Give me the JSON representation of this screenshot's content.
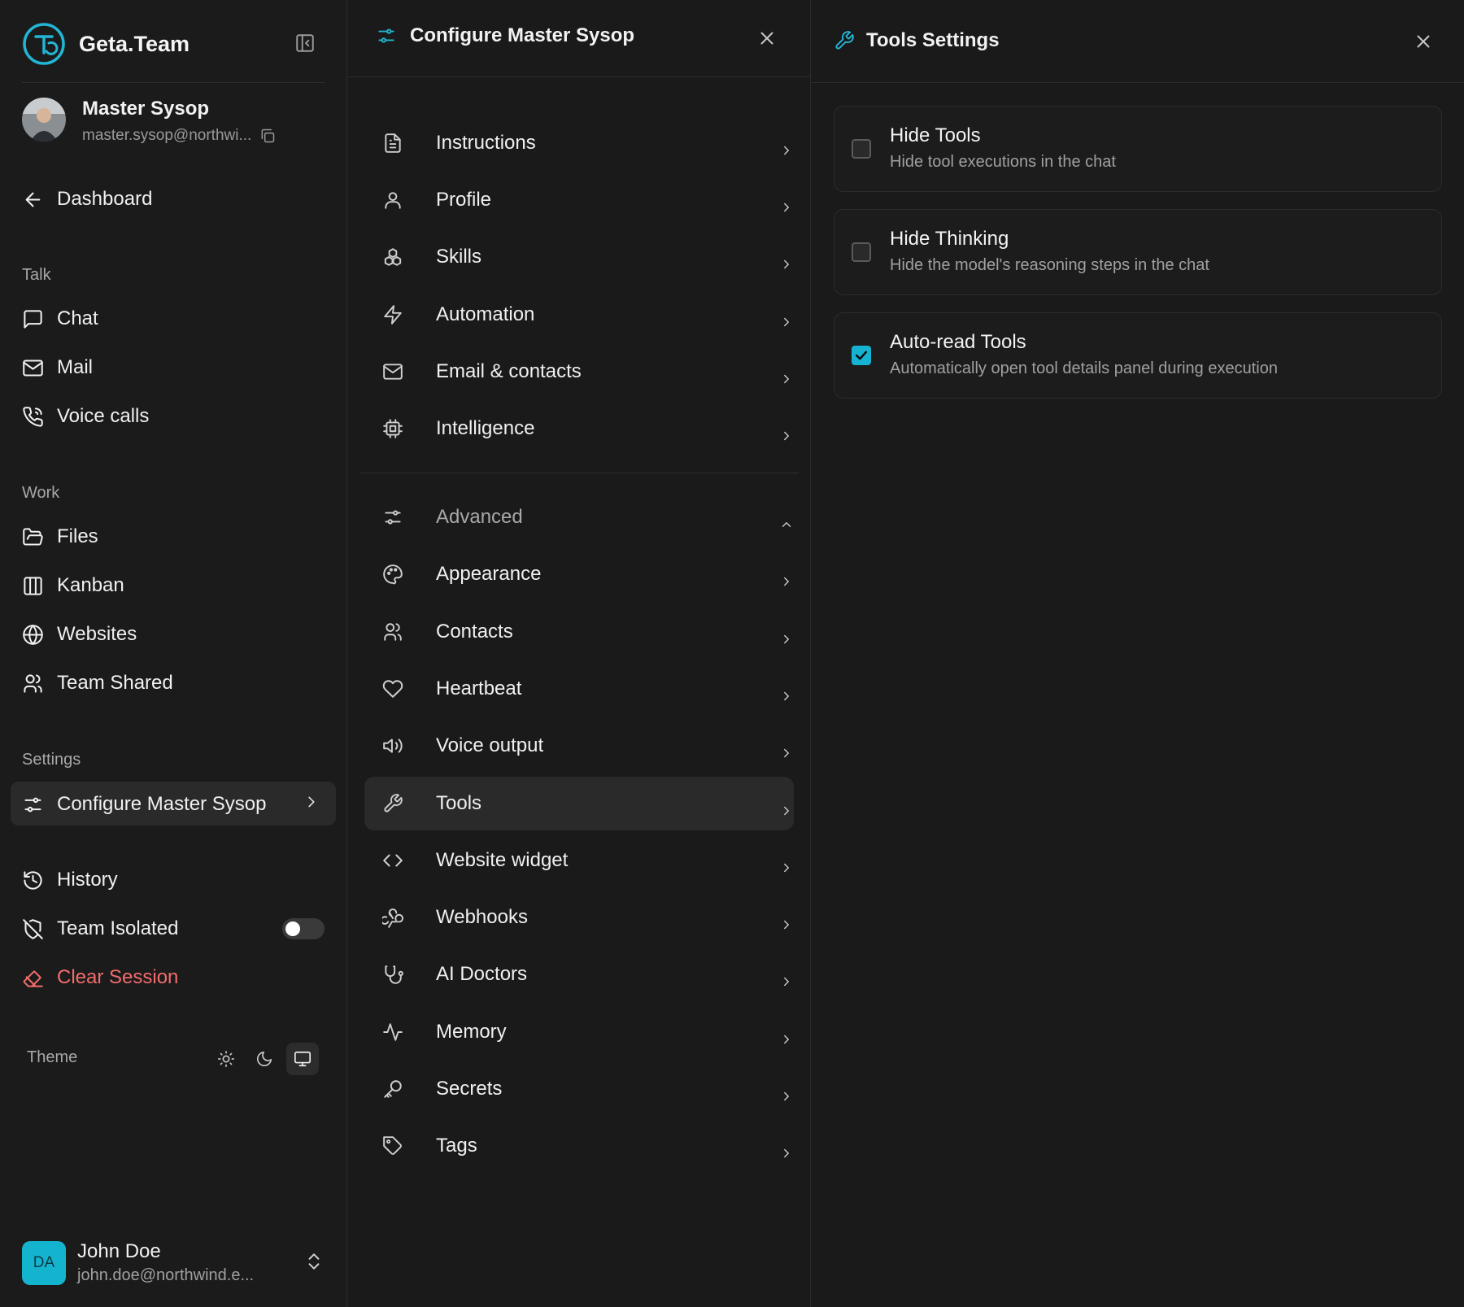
{
  "brand": {
    "name": "Geta.Team",
    "accent": "#22b5d4"
  },
  "user": {
    "name": "Master Sysop",
    "email": "master.sysop@northwi..."
  },
  "nav": {
    "dashboard": "Dashboard",
    "talk_label": "Talk",
    "chat": "Chat",
    "mail": "Mail",
    "voice_calls": "Voice calls",
    "work_label": "Work",
    "files": "Files",
    "kanban": "Kanban",
    "websites": "Websites",
    "team_shared": "Team Shared",
    "settings_label": "Settings",
    "configure": "Configure Master Sysop",
    "history": "History",
    "team_isolated": "Team Isolated",
    "team_isolated_on": false,
    "clear_session": "Clear Session",
    "theme_label": "Theme",
    "theme_selected": "system"
  },
  "footer_user": {
    "initials": "DA",
    "name": "John Doe",
    "email": "john.doe@northwind.e..."
  },
  "config": {
    "title": "Configure Master Sysop",
    "items": [
      {
        "label": "Instructions",
        "icon": "document-icon"
      },
      {
        "label": "Profile",
        "icon": "user-icon"
      },
      {
        "label": "Skills",
        "icon": "skills-icon"
      },
      {
        "label": "Automation",
        "icon": "lightning-icon"
      },
      {
        "label": "Email & contacts",
        "icon": "mail-icon"
      },
      {
        "label": "Intelligence",
        "icon": "chip-icon"
      }
    ],
    "advanced_label": "Advanced",
    "advanced_items": [
      {
        "label": "Appearance",
        "icon": "palette-icon"
      },
      {
        "label": "Contacts",
        "icon": "users-icon"
      },
      {
        "label": "Heartbeat",
        "icon": "heart-icon"
      },
      {
        "label": "Voice output",
        "icon": "speaker-icon"
      },
      {
        "label": "Tools",
        "icon": "wrench-icon",
        "active": true
      },
      {
        "label": "Website widget",
        "icon": "code-icon"
      },
      {
        "label": "Webhooks",
        "icon": "webhook-icon"
      },
      {
        "label": "AI Doctors",
        "icon": "stethoscope-icon"
      },
      {
        "label": "Memory",
        "icon": "activity-icon"
      },
      {
        "label": "Secrets",
        "icon": "key-icon"
      },
      {
        "label": "Tags",
        "icon": "tag-icon"
      }
    ]
  },
  "tools": {
    "title": "Tools Settings",
    "options": [
      {
        "title": "Hide Tools",
        "desc": "Hide tool executions in the chat",
        "checked": false
      },
      {
        "title": "Hide Thinking",
        "desc": "Hide the model's reasoning steps in the chat",
        "checked": false
      },
      {
        "title": "Auto-read Tools",
        "desc": "Automatically open tool details panel during execution",
        "checked": true
      }
    ],
    "checkbox_color": "#16b2d1"
  }
}
